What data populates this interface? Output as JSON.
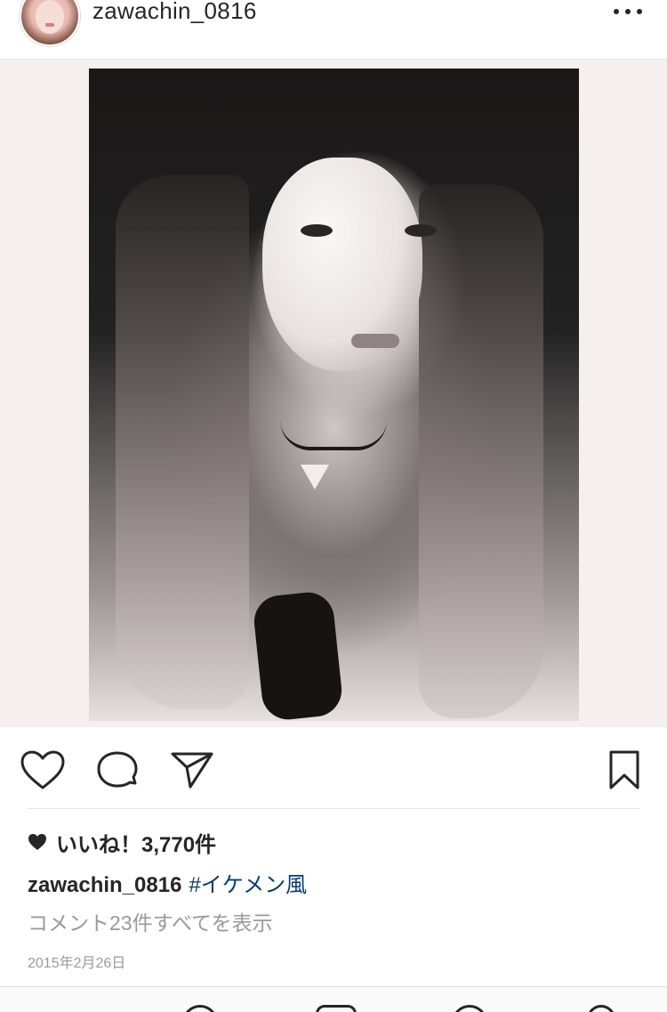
{
  "post": {
    "username": "zawachin_0816",
    "more_icon": "more-horizontal-icon",
    "photo_description_icon": "photo"
  },
  "actions": {
    "like_icon": "heart-outline-icon",
    "comment_icon": "comment-bubble-icon",
    "share_icon": "paper-plane-icon",
    "save_icon": "bookmark-icon"
  },
  "likes": {
    "text": "いいね！3,770件"
  },
  "caption": {
    "username": "zawachin_0816",
    "hashtag": "#イケメン風"
  },
  "comments": {
    "view_all": "コメント23件すべてを表示"
  },
  "date": "2015年2月26日",
  "colors": {
    "text": "#262626",
    "hashtag": "#0a3b6b",
    "muted": "#9a9a9a",
    "photo_bg": "#f6efef"
  }
}
